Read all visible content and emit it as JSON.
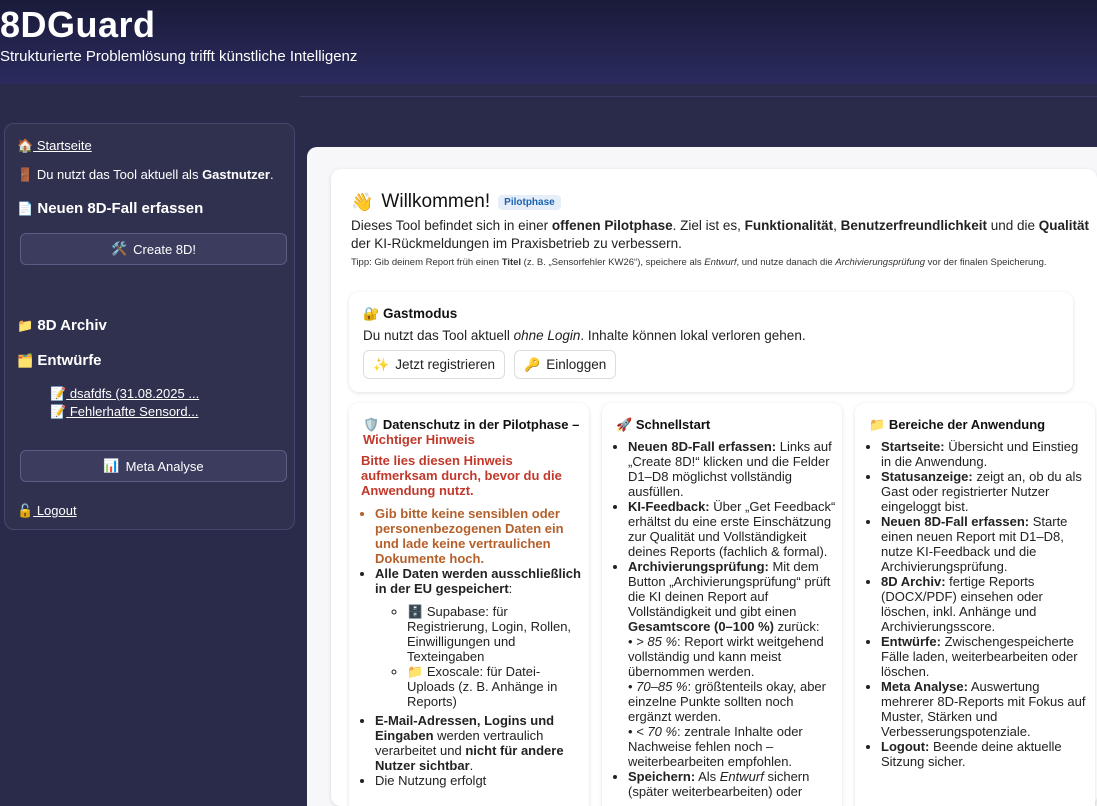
{
  "header": {
    "title": "8DGuard",
    "subtitle": "Strukturierte Problemlösung trifft künstliche Intelligenz"
  },
  "sidebar": {
    "home": "Startseite",
    "guest_prefix": "Du nutzt das Tool aktuell als ",
    "guest_bold": "Gastnutzer",
    "guest_suffix": ".",
    "new_case": "Neuen 8D-Fall erfassen",
    "create_btn": "Create 8D!",
    "archive": "8D Archiv",
    "drafts": "Entwürfe",
    "draft_items": [
      "dsafdfs (31.08.2025 ...",
      "Fehlerhafte Sensord..."
    ],
    "meta_btn": "Meta Analyse",
    "logout": "Logout"
  },
  "welcome": {
    "title": "Willkommen!",
    "badge": "Pilotphase",
    "body_1": "Dieses Tool befindet sich in einer ",
    "body_b1": "offenen Pilotphase",
    "body_2": ". Ziel ist es, ",
    "body_b2": "Funktionalität",
    "body_3": ", ",
    "body_b3": "Benutzerfreundlichkeit",
    "body_4": " und die ",
    "body_b4": "Qualität",
    "body_5": " der KI-Rückmeldungen im Praxisbetrieb zu verbessern.",
    "tip_1": "Tipp: Gib deinem Report früh einen ",
    "tip_b1": "Titel",
    "tip_2": " (z. B. „Sensorfehler KW26“), speichere als ",
    "tip_i1": "Entwurf",
    "tip_3": ", und nutze danach die ",
    "tip_i2": "Archivierungsprüfung",
    "tip_4": " vor der finalen Speicherung."
  },
  "guest": {
    "title": "Gastmodus",
    "text_1": "Du nutzt das Tool aktuell ",
    "text_i": "ohne Login",
    "text_2": ". Inhalte können lokal verloren gehen.",
    "register_btn": "Jetzt registrieren",
    "login_btn": "Einloggen"
  },
  "privacy": {
    "title": "Datenschutz in der Pilotphase –",
    "title_red": "Wichtiger Hinweis",
    "alert": "Bitte lies diesen Hinweis aufmerksam durch, bevor du die Anwendung nutzt.",
    "b1": "Gib bitte keine sensiblen oder personenbezogenen Daten ein und lade keine vertraulichen Dokumente hoch.",
    "b2_bold": "Alle Daten werden ausschließlich in der EU gespeichert",
    "b2_rest": ":",
    "sub1": "Supabase: für Registrierung, Login, Rollen, Einwilligungen und Texteingaben",
    "sub2": "Exoscale: für Datei-Uploads (z. B. Anhänge in Reports)",
    "b3_bold": "E-Mail-Adressen, Logins und Eingaben",
    "b3_mid": " werden vertraulich verarbeitet und ",
    "b3_bold2": "nicht für andere Nutzer sichtbar",
    "b3_end": ".",
    "b4": "Die Nutzung erfolgt"
  },
  "quick": {
    "title": "Schnellstart",
    "i1_b": "Neuen 8D-Fall erfassen:",
    "i1": " Links auf „Create 8D!“ klicken und die Felder D1–D8 möglichst vollständig ausfüllen.",
    "i2_b": "KI-Feedback:",
    "i2": " Über „Get Feedback“ erhältst du eine erste Einschätzung zur Qualität und Vollständigkeit deines Reports (fachlich & formal).",
    "i3_b": "Archivierungsprüfung:",
    "i3": " Mit dem Button „Archivierungsprüfung“ prüft die KI deinen Report auf Vollständigkeit und gibt einen ",
    "i3_b2": "Gesamtscore (0–100 %)",
    "i3_end": " zurück:",
    "s1_i": "> 85 %",
    "s1": ": Report wirkt weitgehend vollständig und kann meist übernommen werden.",
    "s2_i": "70–85 %",
    "s2": ": größtenteils okay, aber einzelne Punkte sollten noch ergänzt werden.",
    "s3_i": "< 70 %",
    "s3": ": zentrale Inhalte oder Nachweise fehlen noch – weiterbearbeiten empfohlen.",
    "i4_b": "Speichern:",
    "i4_pre": " Als ",
    "i4_i": "Entwurf",
    "i4": " sichern (später weiterbearbeiten) oder"
  },
  "areas": {
    "title": "Bereiche der Anwendung",
    "items": [
      {
        "b": "Startseite:",
        "t": " Übersicht und Einstieg in die Anwendung."
      },
      {
        "b": "Statusanzeige:",
        "t": " zeigt an, ob du als Gast oder registrierter Nutzer eingeloggt bist."
      },
      {
        "b": "Neuen 8D-Fall erfassen:",
        "t": " Starte einen neuen Report mit D1–D8, nutze KI-Feedback und die Archivierungsprüfung."
      },
      {
        "b": "8D Archiv:",
        "t": " fertige Reports (DOCX/PDF) einsehen oder löschen, inkl. Anhänge und Archivierungsscore."
      },
      {
        "b": "Entwürfe:",
        "t": " Zwischengespeicherte Fälle laden, weiterbearbeiten oder löschen."
      },
      {
        "b": "Meta Analyse:",
        "t": " Auswertung mehrerer 8D-Reports mit Fokus auf Muster, Stärken und Verbesserungspotenziale."
      },
      {
        "b": "Logout:",
        "t": " Beende deine aktuelle Sitzung sicher."
      }
    ]
  },
  "colors": {
    "accent": "#1c63b0",
    "warning": "#b5602b",
    "danger": "#c0392b",
    "header": "#1a1a3a"
  }
}
